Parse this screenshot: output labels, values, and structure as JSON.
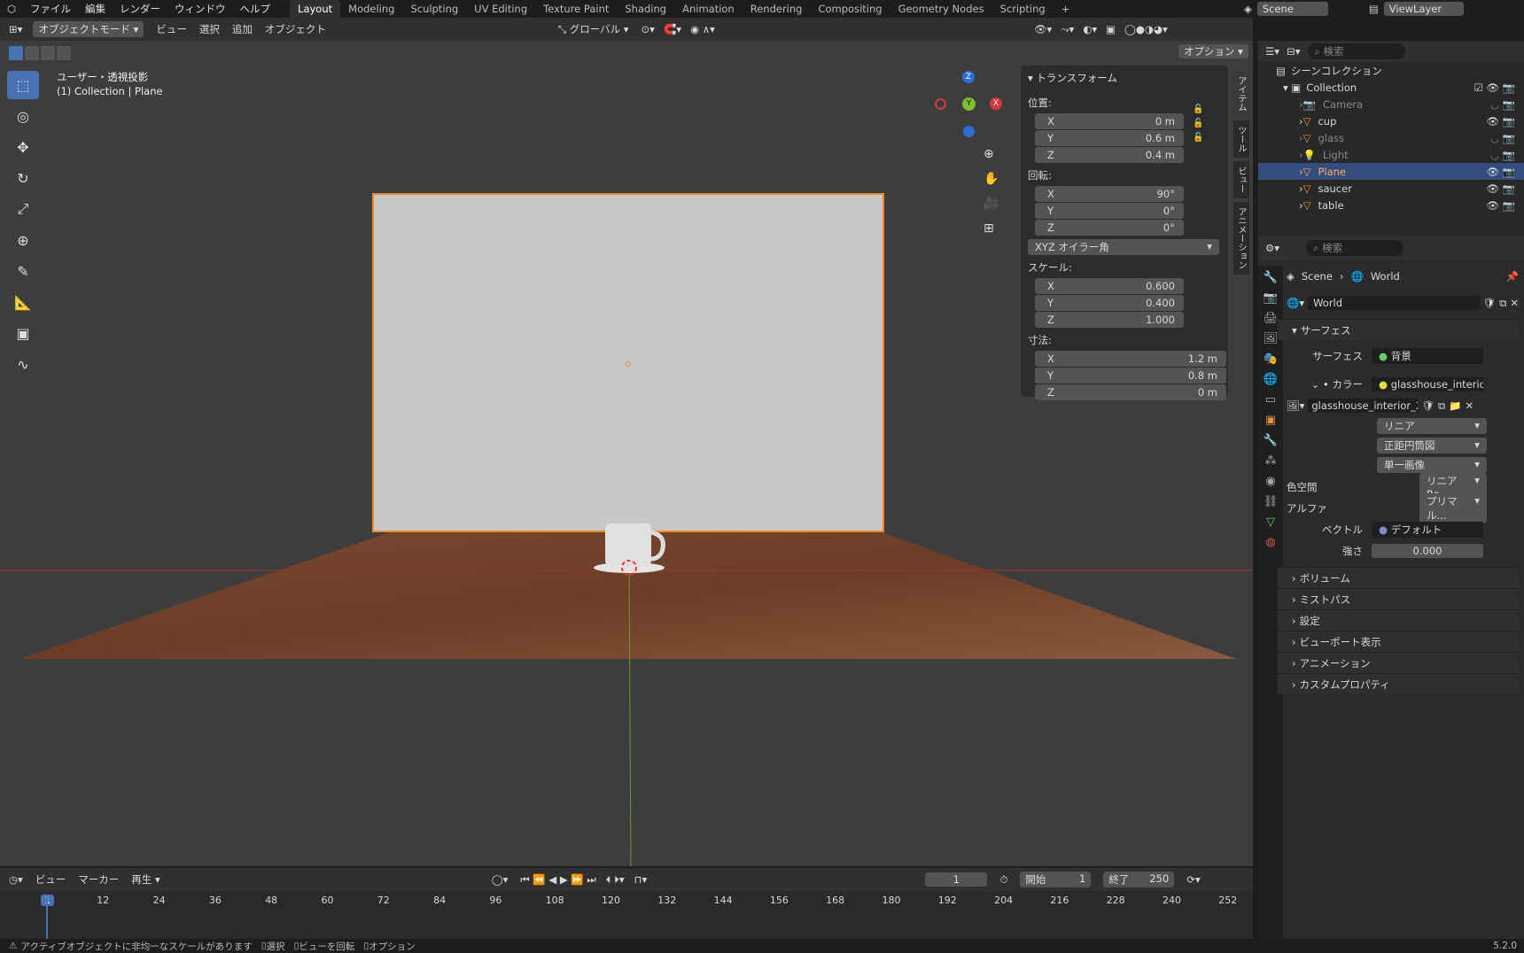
{
  "menu": [
    "ファイル",
    "編集",
    "レンダー",
    "ウィンドウ",
    "ヘルプ"
  ],
  "workspaces": [
    "Layout",
    "Modeling",
    "Sculpting",
    "UV Editing",
    "Texture Paint",
    "Shading",
    "Animation",
    "Rendering",
    "Compositing",
    "Geometry Nodes",
    "Scripting"
  ],
  "scene": "Scene",
  "viewlayer": "ViewLayer",
  "header": {
    "mode": "オブジェクトモード",
    "view": "ビュー",
    "select": "選択",
    "add": "追加",
    "object": "オブジェクト",
    "orientation": "グローバル",
    "options": "オプション"
  },
  "viewport": {
    "title": "ユーザー・透視投影",
    "subtitle": "(1) Collection | Plane"
  },
  "npanel": {
    "section": "トランスフォーム",
    "location": "位置:",
    "loc": [
      "0 m",
      "0.6 m",
      "0.4 m"
    ],
    "rotation": "回転:",
    "rot": [
      "90°",
      "0°",
      "0°"
    ],
    "rotmode": "XYZ オイラー角",
    "scale": "スケール:",
    "scl": [
      "0.600",
      "0.400",
      "1.000"
    ],
    "dimensions": "寸法:",
    "dim": [
      "1.2 m",
      "0.8 m",
      "0 m"
    ],
    "axes": [
      "X",
      "Y",
      "Z"
    ]
  },
  "sidetabs": [
    "アイテム",
    "ツール",
    "ビュー",
    "アニメーション"
  ],
  "outliner": {
    "search": "検索",
    "root": "シーンコレクション",
    "collection": "Collection",
    "items": [
      "Camera",
      "cup",
      "glass",
      "Light",
      "Plane",
      "saucer",
      "table"
    ]
  },
  "props": {
    "search": "検索",
    "crumb1": "Scene",
    "crumb2": "World",
    "world": "World",
    "surface_sec": "サーフェス",
    "surface": "サーフェス",
    "surface_val": "背景",
    "color": "カラー",
    "color_val": "glasshouse_interio...",
    "image": "glasshouse_interior_2...",
    "interp": "リニア",
    "proj": "正距円筒図",
    "source": "単一画像",
    "colorspace": "色空間",
    "colorspace_val": "リニア Re...",
    "alpha": "アルファ",
    "alpha_val": "プリマル...",
    "vector": "ベクトル",
    "vector_val": "デフォルト",
    "strength": "強さ",
    "strength_val": "0.000",
    "sections": [
      "ボリューム",
      "ミストパス",
      "設定",
      "ビューポート表示",
      "アニメーション",
      "カスタムプロパティ"
    ]
  },
  "timeline": {
    "view": "ビュー",
    "marker": "マーカー",
    "play": "再生",
    "frame": "1",
    "start_label": "開始",
    "start": "1",
    "end_label": "終了",
    "end": "250",
    "ticks": [
      "1",
      "12",
      "24",
      "36",
      "48",
      "60",
      "72",
      "84",
      "96",
      "108",
      "120",
      "132",
      "144",
      "156",
      "168",
      "180",
      "192",
      "204",
      "216",
      "228",
      "240",
      "252"
    ]
  },
  "status": {
    "warning": "アクティブオブジェクトに非均一なスケールがあります",
    "select": "選択",
    "rotate": "ビューを回転",
    "options": "オプション",
    "version": "5.2.0"
  },
  "gizmo": {
    "z": "Z",
    "y": "Y",
    "x": "X"
  }
}
